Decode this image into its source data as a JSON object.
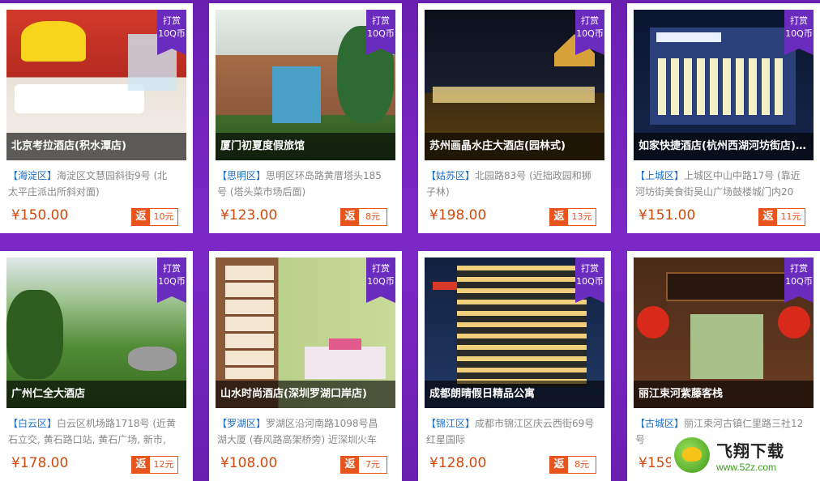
{
  "ribbon": {
    "line1": "打赏",
    "line2": "10Q币"
  },
  "rebate_tag": "返",
  "hotels": [
    {
      "name": "北京考拉酒店(积水潭店)",
      "district": "【海淀区】",
      "address": "海淀区文慧园斜街9号 (北太平庄派出所斜对面)",
      "price": "¥150.00",
      "rebate": "10元",
      "scene": "bedroom"
    },
    {
      "name": "厦门初夏度假旅馆",
      "district": "【思明区】",
      "address": "思明区环岛路黄厝塔头185号 (塔头菜市场后面)",
      "price": "¥123.00",
      "rebate": "8元",
      "scene": "courtyard"
    },
    {
      "name": "苏州画晶水庄大酒店(园林式)",
      "district": "【姑苏区】",
      "address": "北园路83号 (近拙政园和狮子林)",
      "price": "¥198.00",
      "rebate": "13元",
      "scene": "night-garden"
    },
    {
      "name": "如家快捷酒店(杭州西湖河坊街店)原…",
      "district": "【上城区】",
      "address": "上城区中山中路17号 (靠近河坊街美食街吴山广场鼓楼城门内20",
      "price": "¥151.00",
      "rebate": "11元",
      "scene": "night-building"
    },
    {
      "name": "广州仁全大酒店",
      "district": "【白云区】",
      "address": "白云区机场路1718号 (近黄石立交, 黄石路口站, 黄石广场, 新市,",
      "price": "¥178.00",
      "rebate": "12元",
      "scene": "garden"
    },
    {
      "name": "山水时尚酒店(深圳罗湖口岸店)",
      "district": "【罗湖区】",
      "address": "罗湖区沿河南路1098号昌湖大厦 (春风路高架桥旁) 近深圳火车",
      "price": "¥108.00",
      "rebate": "7元",
      "scene": "room-green"
    },
    {
      "name": "成都朗晴假日精品公寓",
      "district": "【锦江区】",
      "address": "成都市锦江区庆云西街69号红星国际",
      "price": "¥128.00",
      "rebate": "8元",
      "scene": "tower"
    },
    {
      "name": "丽江束河紫藤客栈",
      "district": "【古城区】",
      "address": "丽江束河古镇仁里路三社12号",
      "price": "¥159.",
      "rebate": "",
      "scene": "inn"
    }
  ],
  "watermark": {
    "title": "飞翔下载",
    "url": "www.52z.com"
  }
}
